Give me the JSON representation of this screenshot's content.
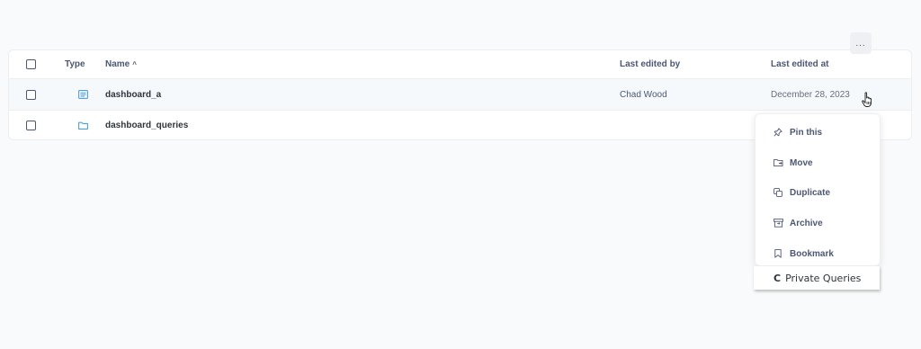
{
  "table": {
    "columns": {
      "type": "Type",
      "name": "Name",
      "name_sort": "^",
      "editor": "Last edited by",
      "edited_at": "Last edited at"
    },
    "rows": [
      {
        "type_icon": "dashboard-icon",
        "name": "dashboard_a",
        "editor": "Chad Wood",
        "edited_at": "December 28, 2023"
      },
      {
        "type_icon": "folder-icon",
        "name": "dashboard_queries",
        "editor": "",
        "edited_at": ""
      }
    ]
  },
  "more_button": {
    "label": "..."
  },
  "menu": {
    "items": [
      {
        "label": "Pin this",
        "icon": "pin-icon"
      },
      {
        "label": "Move",
        "icon": "move-icon"
      },
      {
        "label": "Duplicate",
        "icon": "duplicate-icon"
      },
      {
        "label": "Archive",
        "icon": "archive-icon"
      },
      {
        "label": "Bookmark",
        "icon": "bookmark-icon"
      }
    ]
  },
  "drag_chip": {
    "letter": "C",
    "label": "Private Queries"
  },
  "colors": {
    "accent": "#509ee3",
    "text": "#4c5773",
    "row_highlight": "#f6f9fc"
  }
}
